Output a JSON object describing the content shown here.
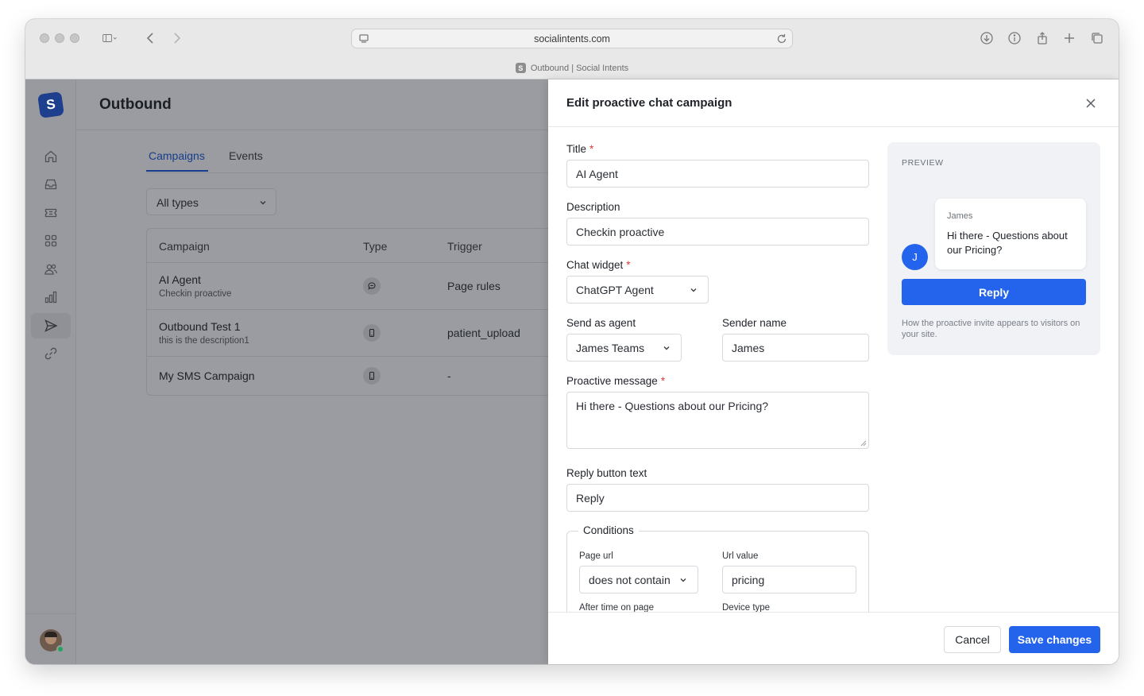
{
  "browser": {
    "url": "socialintents.com",
    "tab_title": "Outbound | Social Intents",
    "favicon_letter": "S"
  },
  "app": {
    "logo_letter": "S",
    "page_title": "Outbound",
    "nav_icons": [
      "home-icon",
      "inbox-icon",
      "ticket-icon",
      "apps-icon",
      "users-icon",
      "reports-icon",
      "send-icon",
      "link-icon"
    ],
    "tabs": [
      {
        "label": "Campaigns",
        "active": true
      },
      {
        "label": "Events",
        "active": false
      }
    ],
    "filter": {
      "value": "All types"
    },
    "table": {
      "headers": [
        "Campaign",
        "Type",
        "Trigger"
      ],
      "rows": [
        {
          "name": "AI Agent",
          "description": "Checkin proactive",
          "type_icon": "chat-icon",
          "trigger": "Page rules"
        },
        {
          "name": "Outbound Test 1",
          "description": "this is the description1",
          "type_icon": "phone-icon",
          "trigger": "patient_upload"
        },
        {
          "name": "My SMS Campaign",
          "description": "",
          "type_icon": "phone-icon",
          "trigger": "-"
        }
      ]
    }
  },
  "panel": {
    "title": "Edit proactive chat campaign",
    "fields": {
      "title_label": "Title",
      "title_value": "AI Agent",
      "description_label": "Description",
      "description_value": "Checkin proactive",
      "widget_label": "Chat widget",
      "widget_value": "ChatGPT Agent",
      "agent_label": "Send as agent",
      "agent_value": "James Teams",
      "sender_label": "Sender name",
      "sender_value": "James",
      "message_label": "Proactive message",
      "message_value": "Hi there - Questions about our Pricing?",
      "reply_label": "Reply button text",
      "reply_value": "Reply",
      "required_mark": "*"
    },
    "conditions": {
      "legend": "Conditions",
      "page_url_label": "Page url",
      "page_url_value": "does not contain",
      "url_value_label": "Url value",
      "url_value": "pricing",
      "time_label": "After time on page",
      "device_label": "Device type"
    },
    "preview": {
      "label": "PREVIEW",
      "sender": "James",
      "message": "Hi there - Questions about our Pricing?",
      "avatar_letter": "J",
      "reply_label": "Reply",
      "note": "How the proactive invite appears to visitors on your site."
    },
    "footer": {
      "cancel_label": "Cancel",
      "save_label": "Save changes"
    }
  },
  "colors": {
    "accent": "#2463eb",
    "tab_active": "#173e8c",
    "required": "#d93a3a",
    "overlay": "#9a9ca1"
  }
}
